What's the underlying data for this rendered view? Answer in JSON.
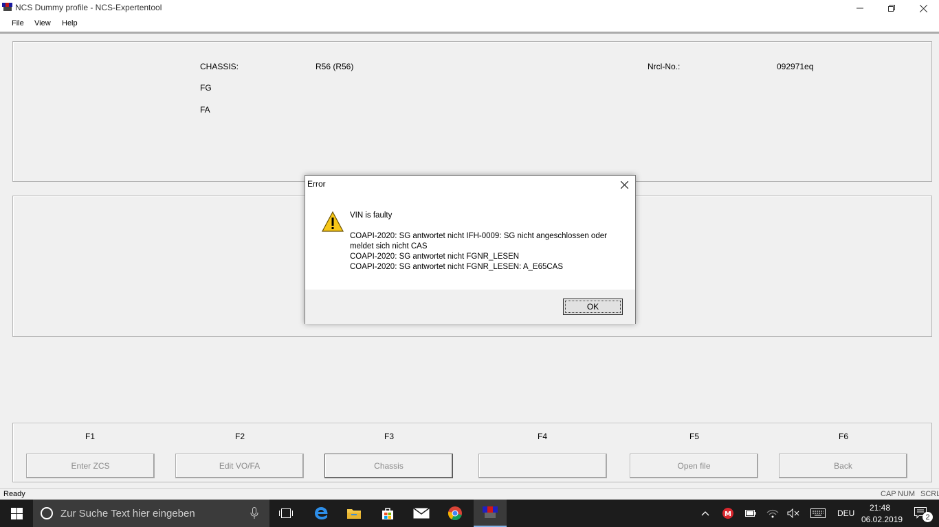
{
  "window": {
    "title": "NCS Dummy profile - NCS-Expertentool"
  },
  "menu": {
    "file": "File",
    "view": "View",
    "help": "Help"
  },
  "info": {
    "chassis_label": "CHASSIS:",
    "chassis_value": "R56 (R56)",
    "nrcl_label": "Nrcl-No.:",
    "nrcl_value": "092971eq",
    "fg_label": "FG",
    "fa_label": "FA"
  },
  "function_keys": [
    {
      "key": "F1",
      "label": "Enter ZCS"
    },
    {
      "key": "F2",
      "label": "Edit VO/FA"
    },
    {
      "key": "F3",
      "label": "Chassis"
    },
    {
      "key": "F4",
      "label": ""
    },
    {
      "key": "F5",
      "label": "Open file"
    },
    {
      "key": "F6",
      "label": "Back"
    }
  ],
  "status": {
    "text": "Ready",
    "cap": "CAP",
    "num": "NUM",
    "scrl": "SCRL"
  },
  "dialog": {
    "title": "Error",
    "icon": "warning-icon",
    "line1": "VIN is faulty",
    "line2": "COAPI-2020: SG antwortet nicht  IFH-0009: SG nicht angeschlossen oder",
    "line3": "meldet sich nicht  CAS",
    "line4": "COAPI-2020: SG antwortet nicht  FGNR_LESEN",
    "line5": "COAPI-2020: SG antwortet nicht  FGNR_LESEN: A_E65CAS",
    "ok": "OK"
  },
  "taskbar": {
    "search_placeholder": "Zur Suche Text hier eingeben",
    "language": "DEU",
    "time": "21:48",
    "date": "06.02.2019",
    "notifications": "2"
  }
}
